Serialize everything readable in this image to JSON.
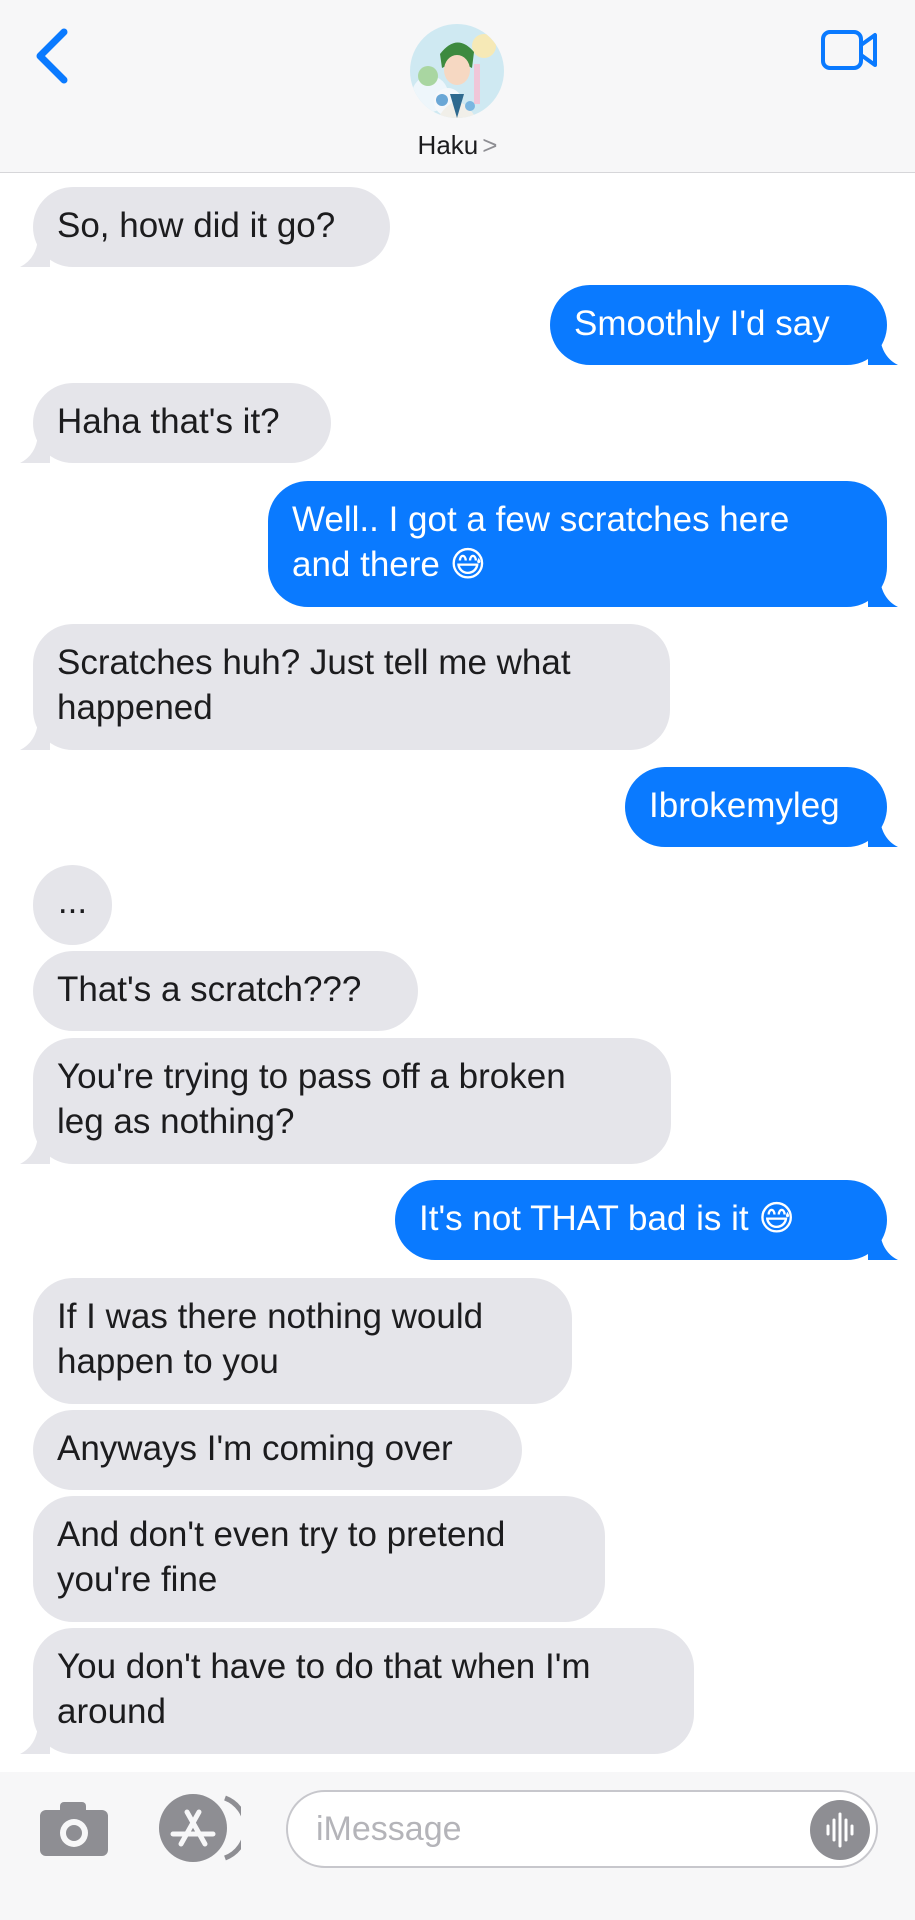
{
  "header": {
    "contact_name": "Haku",
    "chevron": ">"
  },
  "colors": {
    "accent": "#0a7aff",
    "received_bubble": "#e5e5ea",
    "header_bg": "#f7f7f8"
  },
  "icons": {
    "back": "chevron-left-icon",
    "video": "video-camera-icon",
    "camera": "camera-icon",
    "apps": "app-store-icon",
    "audio": "audio-waveform-icon"
  },
  "messages": [
    {
      "from": "them",
      "text": "So, how did it go?"
    },
    {
      "from": "me",
      "text": "Smoothly I'd say"
    },
    {
      "from": "them",
      "text": "Haha that's it?"
    },
    {
      "from": "me",
      "text": "Well.. I got a few scratches here\nand there 😅"
    },
    {
      "from": "them",
      "text": "Scratches huh? Just tell me what\nhappened"
    },
    {
      "from": "me",
      "text": "Ibrokemyleg"
    },
    {
      "from": "them",
      "text": "..."
    },
    {
      "from": "them",
      "text": "That's a scratch???"
    },
    {
      "from": "them",
      "text": "You're trying to pass off a broken\nleg as nothing?"
    },
    {
      "from": "me",
      "text": "It's not THAT bad is it 😅"
    },
    {
      "from": "them",
      "text": "If I was there nothing would\nhappen to you"
    },
    {
      "from": "them",
      "text": "Anyways I'm coming over"
    },
    {
      "from": "them",
      "text": "And don't even try to pretend\nyou're fine"
    },
    {
      "from": "them",
      "text": "You don't have to do that when I'm\naround"
    }
  ],
  "composer": {
    "placeholder": "iMessage",
    "value": ""
  }
}
